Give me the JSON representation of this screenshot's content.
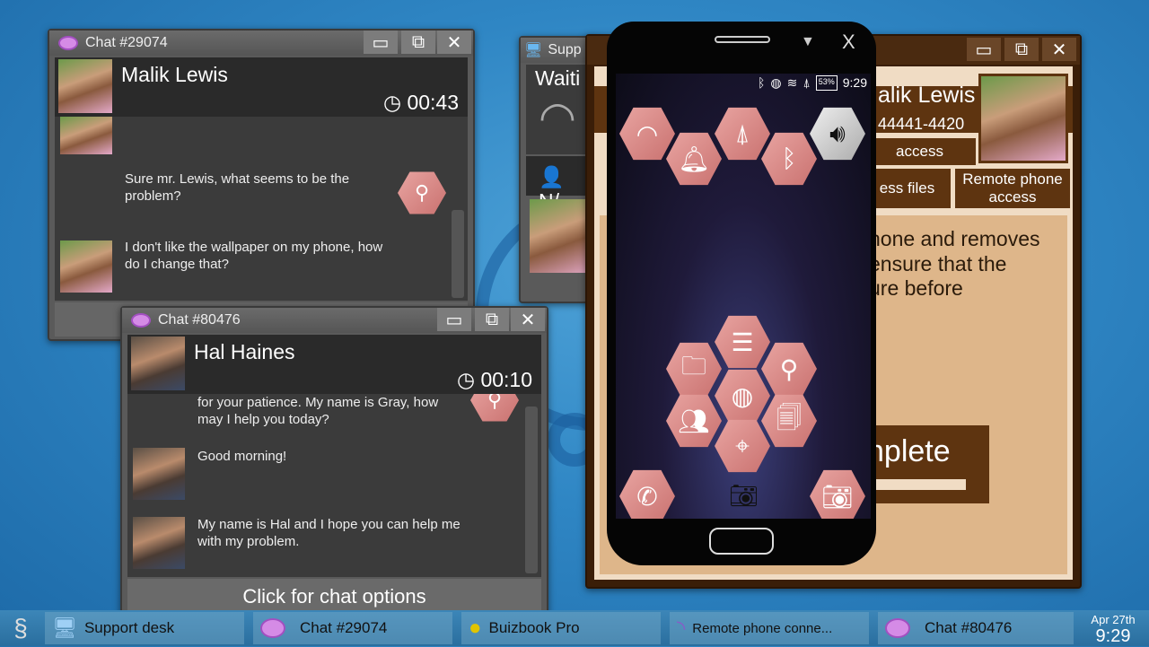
{
  "chat1": {
    "title": "Chat #29074",
    "name": "Malik Lewis",
    "timer": "00:43",
    "messages": [
      "Sure mr. Lewis, what seems to be the problem?",
      "I don't like the wallpaper on my phone, how do I change that?"
    ]
  },
  "chat2": {
    "title": "Chat #80476",
    "name": "Hal Haines",
    "timer": "00:10",
    "messages": [
      "for your patience. My name is Gray, how may I help you today?",
      "Good morning!",
      "My name is Hal and I hope you can help me with my problem."
    ],
    "options_label": "Click for chat options"
  },
  "support": {
    "title": "Supp",
    "status": "Waiti",
    "name": "N/"
  },
  "buizbook": {
    "name": "alik Lewis",
    "phone": "44441-4420",
    "btn_access": "access",
    "btn_files": "ess files",
    "btn_remote": "Remote phone access",
    "body_lines": [
      "hone and removes",
      "ensure that the",
      "ure before"
    ],
    "complete_label": "nplete",
    "progress_pct": 100
  },
  "phone": {
    "time": "9:29",
    "battery": "53%",
    "close": "X",
    "quick_icons": [
      "wifi-icon",
      "bell-icon",
      "antenna-icon",
      "bluetooth-icon",
      "speaker-icon"
    ],
    "apps": [
      "menu-icon",
      "folder-icon",
      "search-network-icon",
      "globe-icon",
      "contacts-icon",
      "documents-icon",
      "location-icon"
    ]
  },
  "taskbar": {
    "items": [
      "Support desk",
      "Chat #29074",
      "Buizbook Pro",
      "Remote phone conne...",
      "Chat #80476"
    ],
    "date": "Apr 27th",
    "time": "9:29"
  },
  "colors": {
    "hex_icon": "#d4817f",
    "buizbook_brown": "#5e3410",
    "buizbook_panel": "#deb68a"
  }
}
